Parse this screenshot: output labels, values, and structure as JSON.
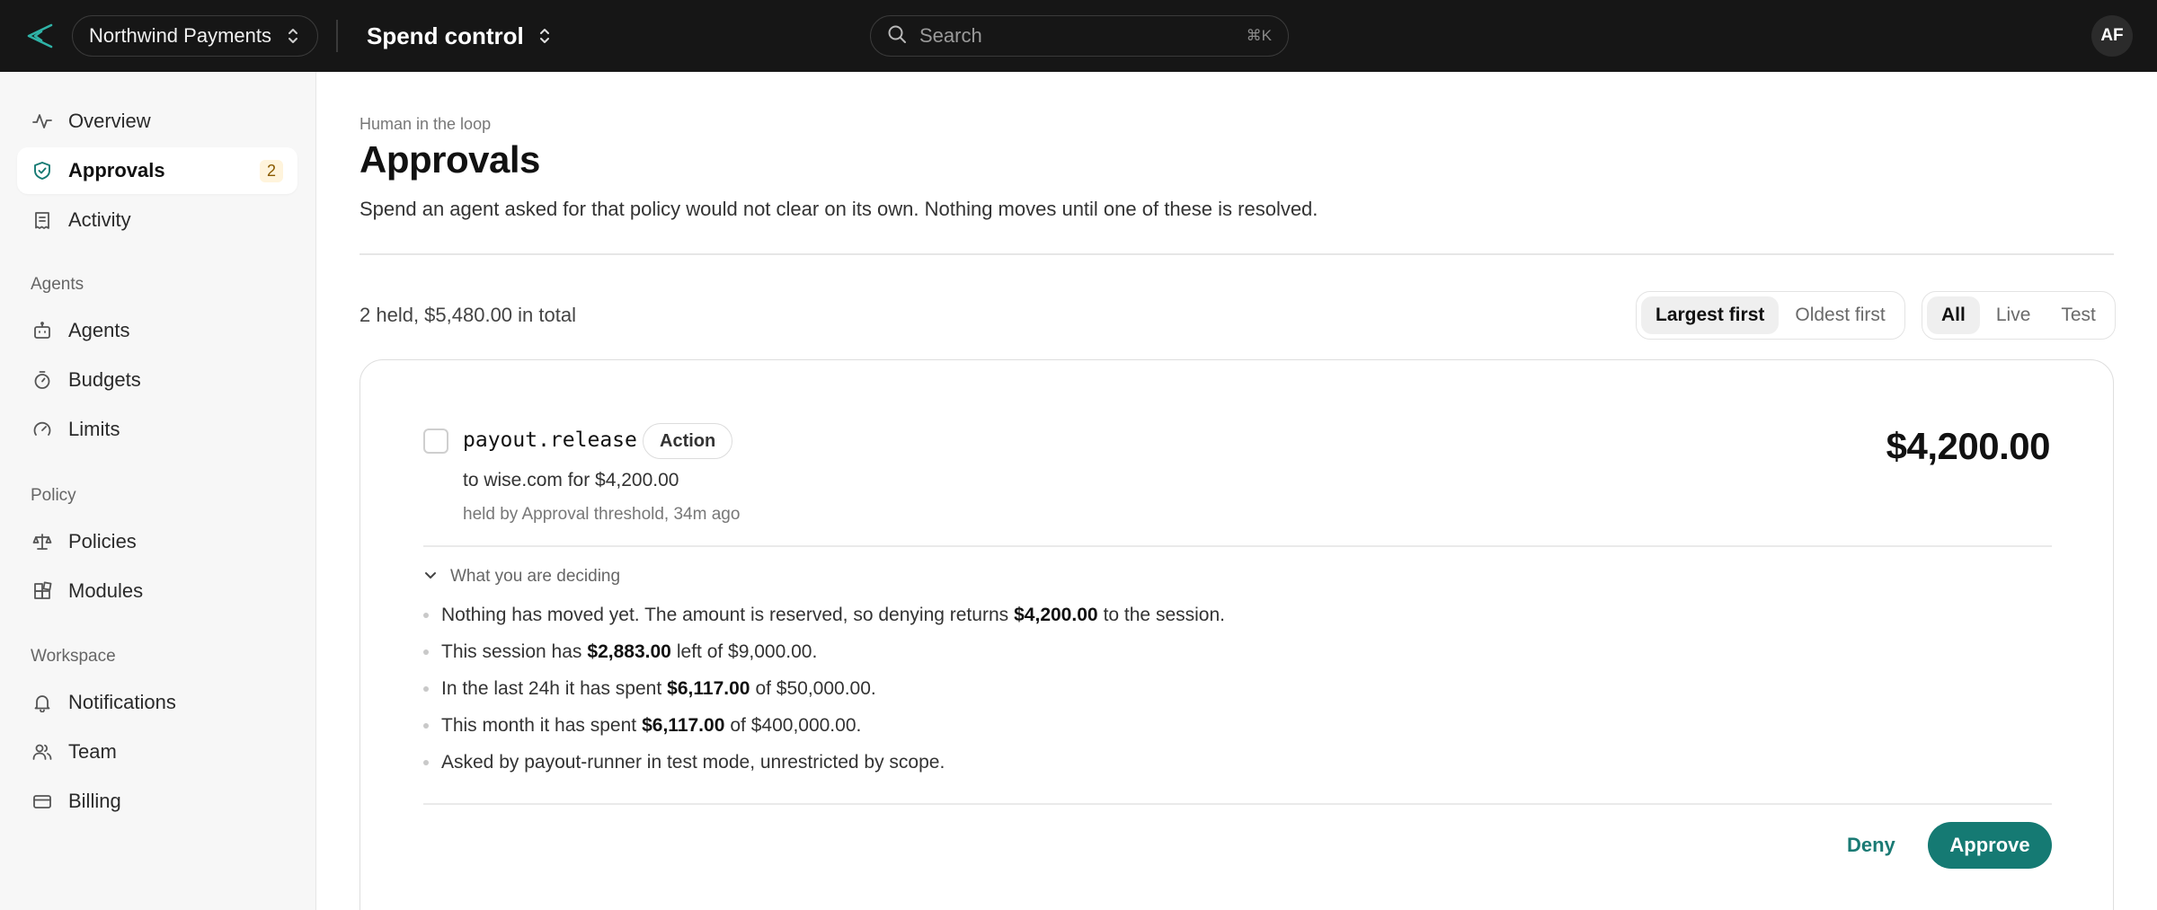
{
  "header": {
    "org_name": "Northwind Payments",
    "product_name": "Spend control",
    "search_placeholder": "Search",
    "search_shortcut": "⌘K",
    "avatar_initials": "AF"
  },
  "sidebar": {
    "items": [
      {
        "label": "Overview",
        "icon": "activity-icon"
      },
      {
        "label": "Approvals",
        "icon": "shield-check-icon",
        "badge": "2",
        "active": true
      },
      {
        "label": "Activity",
        "icon": "receipt-icon"
      }
    ],
    "sections": [
      {
        "title": "Agents",
        "items": [
          {
            "label": "Agents",
            "icon": "bot-icon"
          },
          {
            "label": "Budgets",
            "icon": "stopwatch-icon"
          },
          {
            "label": "Limits",
            "icon": "gauge-icon"
          }
        ]
      },
      {
        "title": "Policy",
        "items": [
          {
            "label": "Policies",
            "icon": "scale-icon"
          },
          {
            "label": "Modules",
            "icon": "blocks-icon"
          }
        ]
      },
      {
        "title": "Workspace",
        "items": [
          {
            "label": "Notifications",
            "icon": "bell-icon"
          },
          {
            "label": "Team",
            "icon": "users-icon"
          },
          {
            "label": "Billing",
            "icon": "credit-card-icon"
          }
        ]
      }
    ]
  },
  "main": {
    "eyebrow": "Human in the loop",
    "title": "Approvals",
    "description": "Spend an agent asked for that policy would not clear on its own. Nothing moves until one of these is resolved.",
    "summary": "2 held, $5,480.00 in total",
    "sort_options": [
      "Largest first",
      "Oldest first"
    ],
    "sort_selected": "Largest first",
    "mode_options": [
      "All",
      "Live",
      "Test"
    ],
    "mode_selected": "All"
  },
  "approval": {
    "action": "payout.release",
    "tag": "Action",
    "description": "to wise.com for $4,200.00",
    "held_by": "held by Approval threshold, 34m ago",
    "amount": "$4,200.00",
    "disclosure_label": "What you are deciding",
    "facts": [
      {
        "pre": "Nothing has moved yet. The amount is reserved, so denying returns",
        "em": "$4,200.00",
        "post": "to the session."
      },
      {
        "pre": "This session has",
        "em": "$2,883.00",
        "post": "left of $9,000.00."
      },
      {
        "pre": "In the last 24h it has spent",
        "em": "$6,117.00",
        "post": "of $50,000.00."
      },
      {
        "pre": "This month it has spent",
        "em": "$6,117.00",
        "post": "of $400,000.00."
      },
      {
        "pre": "Asked by payout-runner in test mode, unrestricted by scope.",
        "em": "",
        "post": ""
      }
    ],
    "deny_label": "Deny",
    "approve_label": "Approve"
  },
  "colors": {
    "accent": "#157a73",
    "topbar": "#161616",
    "badge_bg": "#fff4dc",
    "badge_text": "#8a5a00"
  }
}
